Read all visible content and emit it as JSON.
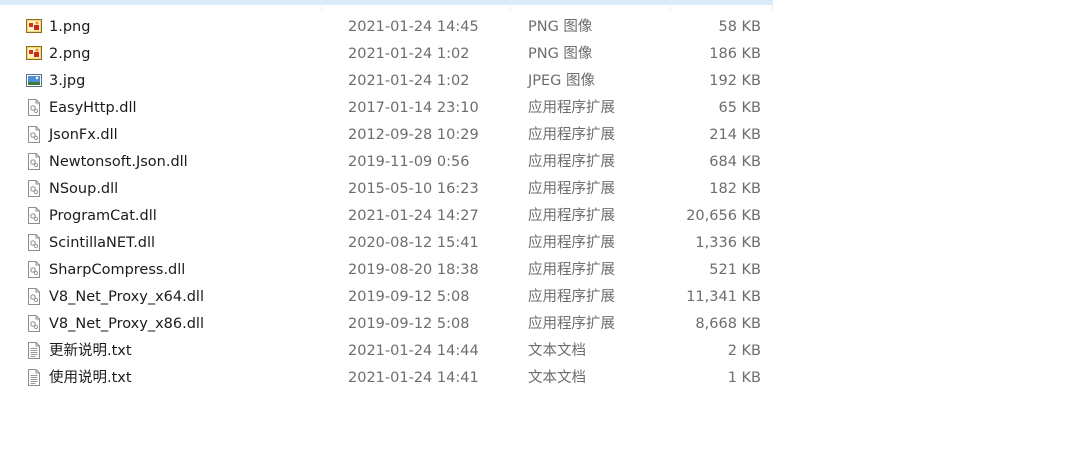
{
  "files": [
    {
      "name": "1.png",
      "date": "2021-01-24 14:45",
      "type": "PNG 图像",
      "size": "58 KB",
      "icon": "png-image-icon"
    },
    {
      "name": "2.png",
      "date": "2021-01-24 1:02",
      "type": "PNG 图像",
      "size": "186 KB",
      "icon": "png-image-icon"
    },
    {
      "name": "3.jpg",
      "date": "2021-01-24 1:02",
      "type": "JPEG 图像",
      "size": "192 KB",
      "icon": "jpeg-image-icon"
    },
    {
      "name": "EasyHttp.dll",
      "date": "2017-01-14 23:10",
      "type": "应用程序扩展",
      "size": "65 KB",
      "icon": "dll-file-icon"
    },
    {
      "name": "JsonFx.dll",
      "date": "2012-09-28 10:29",
      "type": "应用程序扩展",
      "size": "214 KB",
      "icon": "dll-file-icon"
    },
    {
      "name": "Newtonsoft.Json.dll",
      "date": "2019-11-09 0:56",
      "type": "应用程序扩展",
      "size": "684 KB",
      "icon": "dll-file-icon"
    },
    {
      "name": "NSoup.dll",
      "date": "2015-05-10 16:23",
      "type": "应用程序扩展",
      "size": "182 KB",
      "icon": "dll-file-icon"
    },
    {
      "name": "ProgramCat.dll",
      "date": "2021-01-24 14:27",
      "type": "应用程序扩展",
      "size": "20,656 KB",
      "icon": "dll-file-icon"
    },
    {
      "name": "ScintillaNET.dll",
      "date": "2020-08-12 15:41",
      "type": "应用程序扩展",
      "size": "1,336 KB",
      "icon": "dll-file-icon"
    },
    {
      "name": "SharpCompress.dll",
      "date": "2019-08-20 18:38",
      "type": "应用程序扩展",
      "size": "521 KB",
      "icon": "dll-file-icon"
    },
    {
      "name": "V8_Net_Proxy_x64.dll",
      "date": "2019-09-12 5:08",
      "type": "应用程序扩展",
      "size": "11,341 KB",
      "icon": "dll-file-icon"
    },
    {
      "name": "V8_Net_Proxy_x86.dll",
      "date": "2019-09-12 5:08",
      "type": "应用程序扩展",
      "size": "8,668 KB",
      "icon": "dll-file-icon"
    },
    {
      "name": "更新说明.txt",
      "date": "2021-01-24 14:44",
      "type": "文本文档",
      "size": "2 KB",
      "icon": "text-document-icon"
    },
    {
      "name": "使用说明.txt",
      "date": "2021-01-24 14:41",
      "type": "文本文档",
      "size": "1 KB",
      "icon": "text-document-icon"
    }
  ],
  "colors": {
    "header_highlight": "#d9ebf9",
    "name_text": "#1b1b1b",
    "detail_text": "#6d6d6d"
  }
}
